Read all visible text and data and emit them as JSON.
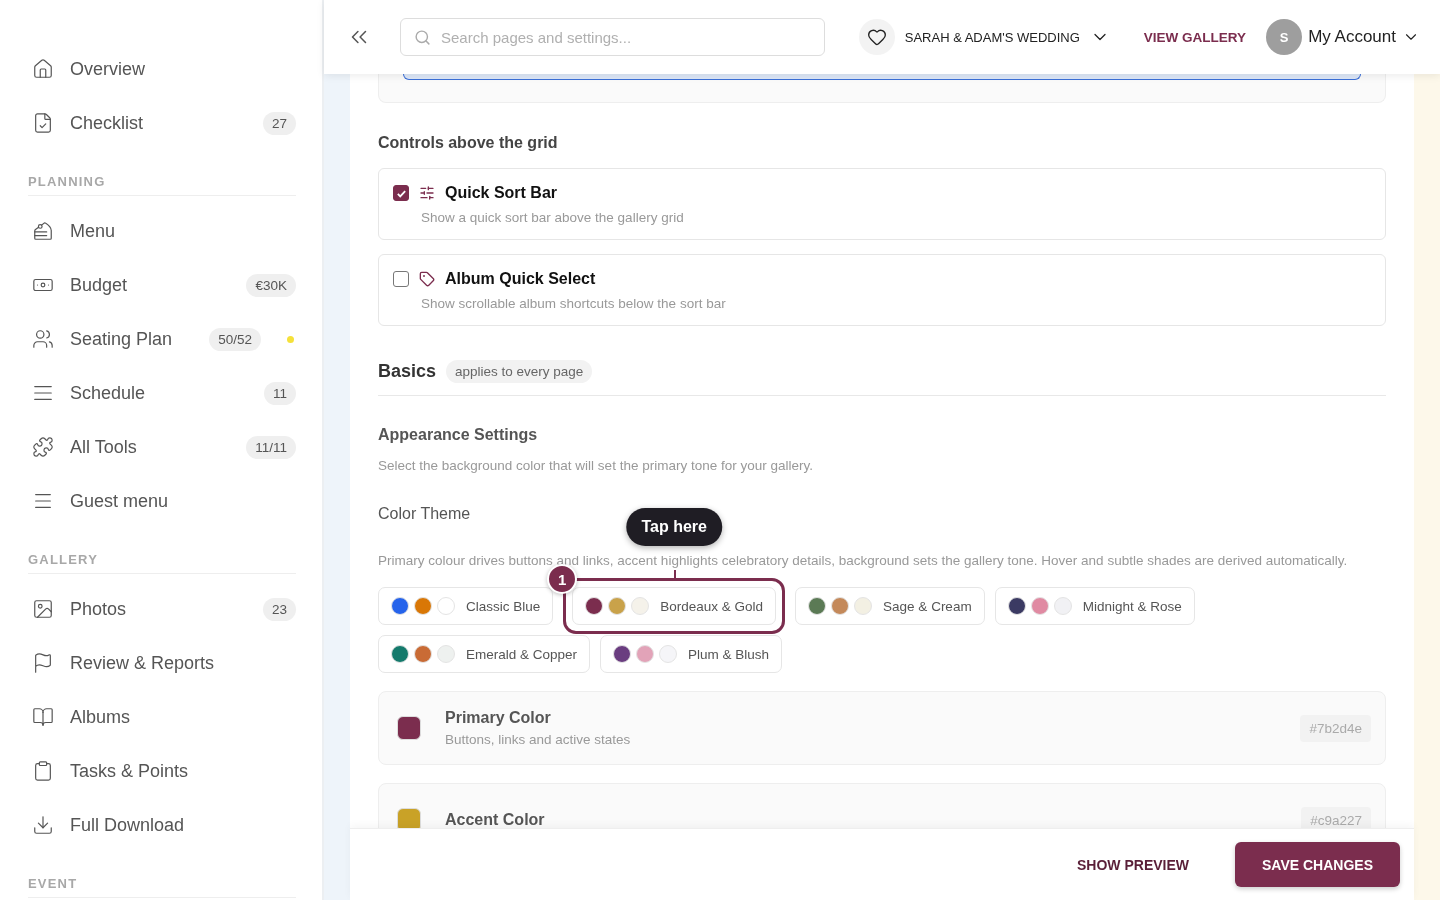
{
  "sidebar": {
    "top_items": [
      {
        "label": "Overview"
      },
      {
        "label": "Checklist",
        "badge": "27"
      }
    ],
    "sections": [
      {
        "title": "PLANNING",
        "items": [
          {
            "label": "Menu"
          },
          {
            "label": "Budget",
            "badge": "€30K"
          },
          {
            "label": "Seating Plan",
            "badge": "50/52",
            "color": "#f5e13a"
          },
          {
            "label": "Schedule",
            "badge": "11"
          },
          {
            "label": "All Tools",
            "badge": "11/11"
          },
          {
            "label": "Guest menu"
          }
        ]
      },
      {
        "title": "GALLERY",
        "items": [
          {
            "label": "Photos",
            "badge": "23"
          },
          {
            "label": "Review & Reports"
          },
          {
            "label": "Albums"
          },
          {
            "label": "Tasks & Points"
          },
          {
            "label": "Full Download"
          }
        ]
      },
      {
        "title": "EVENT"
      }
    ]
  },
  "header": {
    "search": {
      "placeholder": "Search pages and settings..."
    },
    "event": "SARAH & ADAM'S WEDDING",
    "view_gallery": "VIEW GALLERY",
    "avatar": "S",
    "account": "My Account"
  },
  "controls": {
    "title": "Controls above the grid",
    "options": [
      {
        "title": "Quick Sort Bar",
        "description": "Show a quick sort bar above the gallery grid",
        "checked": true
      },
      {
        "title": "Album Quick Select",
        "description": "Show scrollable album shortcuts below the sort bar",
        "checked": false
      }
    ]
  },
  "basics": {
    "title": "Basics",
    "tag": "applies to every page"
  },
  "appearance": {
    "title": "Appearance Settings",
    "description": "Select the background color that will set the primary tone for your gallery."
  },
  "color_theme": {
    "title": "Color Theme",
    "description": "Primary colour drives buttons and links, accent highlights celebratory details, background sets the gallery tone. Hover and subtle shades are derived automatically.",
    "themes": [
      {
        "label": "Classic Blue",
        "swatches": [
          {
            "color": "#2563eb"
          },
          {
            "color": "#d97706"
          },
          {
            "color": "#ffffff"
          }
        ],
        "selected": false
      },
      {
        "label": "Bordeaux & Gold",
        "swatches": [
          {
            "color": "#7b2d4e"
          },
          {
            "color": "#c9a24a"
          },
          {
            "color": "#f5f2ea"
          }
        ],
        "selected": true,
        "tour": {
          "label": "Tap here",
          "step": "1"
        }
      },
      {
        "label": "Sage & Cream",
        "swatches": [
          {
            "color": "#5b7a55"
          },
          {
            "color": "#c4895a"
          },
          {
            "color": "#f3f0e3"
          }
        ],
        "selected": false
      },
      {
        "label": "Midnight & Rose",
        "swatches": [
          {
            "color": "#3b3a63"
          },
          {
            "color": "#e08aa2"
          },
          {
            "color": "#f1f1f4"
          }
        ],
        "selected": false
      },
      {
        "label": "Emerald & Copper",
        "swatches": [
          {
            "color": "#147a6c"
          },
          {
            "color": "#c96b35"
          },
          {
            "color": "#eef1ef"
          }
        ],
        "selected": false
      },
      {
        "label": "Plum & Blush",
        "swatches": [
          {
            "color": "#6a3d80"
          },
          {
            "color": "#e2a3b8"
          },
          {
            "color": "#f5f5f8"
          }
        ],
        "selected": false
      }
    ]
  },
  "color_fields": [
    {
      "title": "Primary Color",
      "description": "Buttons, links and active states",
      "color": "#7b2d4e",
      "hex": "#7b2d4e"
    },
    {
      "title": "Accent Color",
      "color": "#c9a227",
      "hex": "#c9a227"
    }
  ],
  "footer": {
    "preview": "SHOW PREVIEW",
    "save": "SAVE CHANGES"
  }
}
